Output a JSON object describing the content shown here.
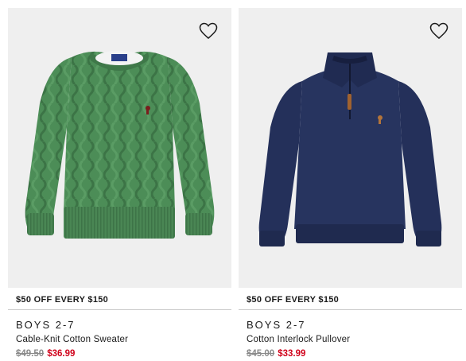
{
  "products": [
    {
      "promo": "$50 OFF EVERY $150",
      "category": "BOYS 2-7",
      "name": "Cable-Knit Cotton Sweater",
      "original_price": "$49.50",
      "sale_price": "$36.99",
      "color": "#4a8a54",
      "favorite_icon": "heart-outline-icon"
    },
    {
      "promo": "$50 OFF EVERY $150",
      "category": "BOYS 2-7",
      "name": "Cotton Interlock Pullover",
      "original_price": "$45.00",
      "sale_price": "$33.99",
      "color": "#23305a",
      "favorite_icon": "heart-outline-icon"
    }
  ],
  "colors": {
    "sale": "#d0021b",
    "strike": "#8a8a8a",
    "card_bg": "#efefef"
  }
}
